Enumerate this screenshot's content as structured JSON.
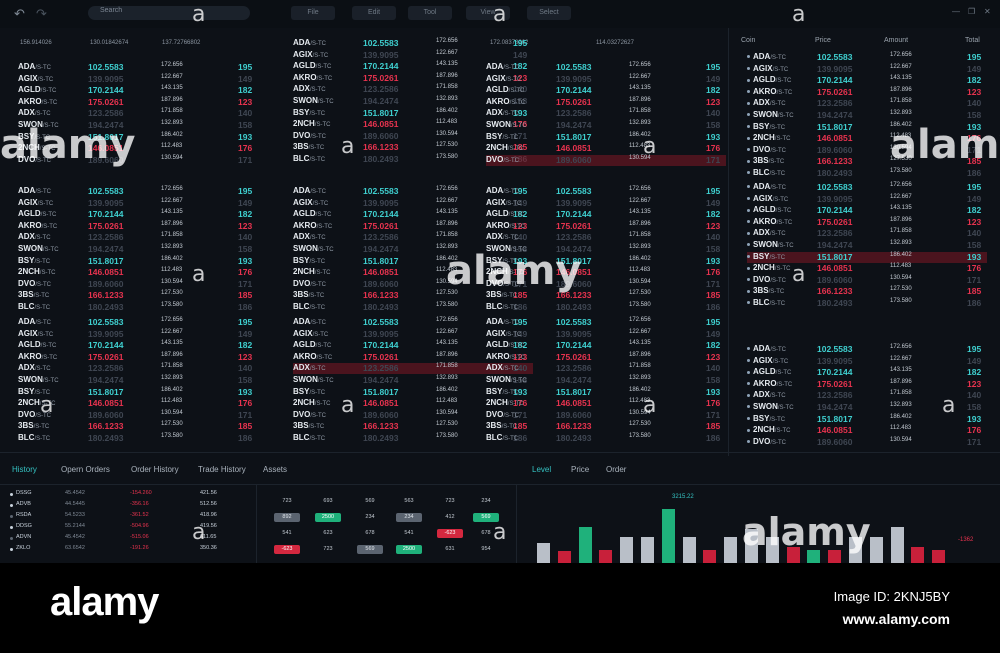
{
  "topbar": {
    "back_icon": "undo-arrow",
    "forward_icon": "redo-arrow",
    "search_placeholder": "Search",
    "menus": [
      "File",
      "Edit",
      "Tool",
      "View",
      "Select"
    ],
    "window_controls": [
      "—",
      "❐",
      "✕"
    ]
  },
  "header_numbers": [
    "156.914026",
    "130.01842674",
    "137.72766802",
    "172.08378262",
    "114.03272627"
  ],
  "coin_header": {
    "coin": "Coin",
    "price": "Price",
    "amount": "Amount",
    "total": "Total"
  },
  "suffix": "/S-TC",
  "coins": [
    {
      "sym": "ADA",
      "price": "102.5583",
      "vol": "172.656",
      "chg": "195",
      "dir": "up"
    },
    {
      "sym": "AGIX",
      "price": "139.9095",
      "vol": "122.667",
      "chg": "149",
      "dir": "dim"
    },
    {
      "sym": "AGLD",
      "price": "170.2144",
      "vol": "143.135",
      "chg": "182",
      "dir": "up"
    },
    {
      "sym": "AKRO",
      "price": "175.0261",
      "vol": "187.896",
      "chg": "123",
      "dir": "dn"
    },
    {
      "sym": "ADX",
      "price": "123.2586",
      "vol": "171.858",
      "chg": "140",
      "dir": "dim"
    },
    {
      "sym": "SWON",
      "price": "194.2474",
      "vol": "132.893",
      "chg": "158",
      "dir": "dim"
    },
    {
      "sym": "BSY",
      "price": "151.8017",
      "vol": "186.402",
      "chg": "193",
      "dir": "up"
    },
    {
      "sym": "2NCH",
      "price": "146.0851",
      "vol": "112.483",
      "chg": "176",
      "dir": "dn"
    },
    {
      "sym": "DVO",
      "price": "189.6060",
      "vol": "130.594",
      "chg": "171",
      "dir": "dim"
    },
    {
      "sym": "3BS",
      "price": "166.1233",
      "vol": "127.530",
      "chg": "185",
      "dir": "dn"
    },
    {
      "sym": "BLC",
      "price": "180.2493",
      "vol": "173.580",
      "chg": "186",
      "dir": "dim"
    }
  ],
  "bottom_tabs_left": [
    "History",
    "Opern Orders",
    "Order History",
    "Trade History",
    "Assets"
  ],
  "bottom_tabs_right": [
    "Level",
    "Price",
    "Order"
  ],
  "history": [
    {
      "name": "DSSG",
      "a": "45.4542",
      "b": "-154.260",
      "c": "421.56",
      "dot": "#c9d2dc"
    },
    {
      "name": "ADVB",
      "a": "44.5445",
      "b": "-356.16",
      "c": "512.56",
      "dot": "#c9d2dc"
    },
    {
      "name": "RSDA",
      "a": "54.5233",
      "b": "-361.52",
      "c": "418.96",
      "dot": "#5d6672"
    },
    {
      "name": "DDSG",
      "a": "55.2144",
      "b": "-504.96",
      "c": "419.56",
      "dot": "#c9d2dc"
    },
    {
      "name": "ADVN",
      "a": "45.4542",
      "b": "-515.06",
      "c": "611.65",
      "dot": "#5d6672"
    },
    {
      "name": "ZKLO",
      "a": "63.6542",
      "b": "-191.26",
      "c": "350.36",
      "dot": "#c9d2dc"
    }
  ],
  "orderbook": [
    [
      {
        "v": "723",
        "t": ""
      },
      {
        "v": "693",
        "t": ""
      },
      {
        "v": "569",
        "t": ""
      },
      {
        "v": "563",
        "t": ""
      },
      {
        "v": "723",
        "t": ""
      },
      {
        "v": "234",
        "t": ""
      }
    ],
    [
      {
        "v": "892",
        "t": "s"
      },
      {
        "v": "2500",
        "t": "g"
      },
      {
        "v": "234",
        "t": ""
      },
      {
        "v": "234",
        "t": "s"
      },
      {
        "v": "412",
        "t": ""
      },
      {
        "v": "569",
        "t": "g"
      }
    ],
    [
      {
        "v": "541",
        "t": ""
      },
      {
        "v": "623",
        "t": ""
      },
      {
        "v": "678",
        "t": ""
      },
      {
        "v": "541",
        "t": ""
      },
      {
        "v": "-623",
        "t": "r"
      },
      {
        "v": "678",
        "t": ""
      }
    ],
    [
      {
        "v": "-623",
        "t": "r"
      },
      {
        "v": "723",
        "t": ""
      },
      {
        "v": "569",
        "t": "s"
      },
      {
        "v": "2500",
        "t": "g"
      },
      {
        "v": "631",
        "t": ""
      },
      {
        "v": "954",
        "t": ""
      }
    ]
  ],
  "level_chart": {
    "peak_label": "3215.22",
    "side_label": "-1362",
    "bars": [
      {
        "v": 0.3,
        "c": "#b9bfc8"
      },
      {
        "v": 0.18,
        "c": "#c8203a"
      },
      {
        "v": 0.55,
        "c": "#1fb17b"
      },
      {
        "v": 0.2,
        "c": "#c8203a"
      },
      {
        "v": 0.4,
        "c": "#b9bfc8"
      },
      {
        "v": 0.4,
        "c": "#b9bfc8"
      },
      {
        "v": 0.82,
        "c": "#1fb17b"
      },
      {
        "v": 0.4,
        "c": "#b9bfc8"
      },
      {
        "v": 0.2,
        "c": "#c8203a"
      },
      {
        "v": 0.4,
        "c": "#b9bfc8"
      },
      {
        "v": 0.52,
        "c": "#b9bfc8"
      },
      {
        "v": 0.4,
        "c": "#b9bfc8"
      },
      {
        "v": 0.25,
        "c": "#c8203a"
      },
      {
        "v": 0.2,
        "c": "#1fb17b"
      },
      {
        "v": 0.2,
        "c": "#c8203a"
      },
      {
        "v": 0.4,
        "c": "#b9bfc8"
      },
      {
        "v": 0.4,
        "c": "#b9bfc8"
      },
      {
        "v": 0.55,
        "c": "#b9bfc8"
      },
      {
        "v": 0.25,
        "c": "#c8203a"
      },
      {
        "v": 0.2,
        "c": "#c8203a"
      }
    ]
  },
  "watermark": {
    "word": "alamy",
    "letter": "a"
  },
  "footer": {
    "logo": "alamy",
    "image_id": "Image ID: 2KNJ5BY",
    "url": "www.alamy.com"
  }
}
